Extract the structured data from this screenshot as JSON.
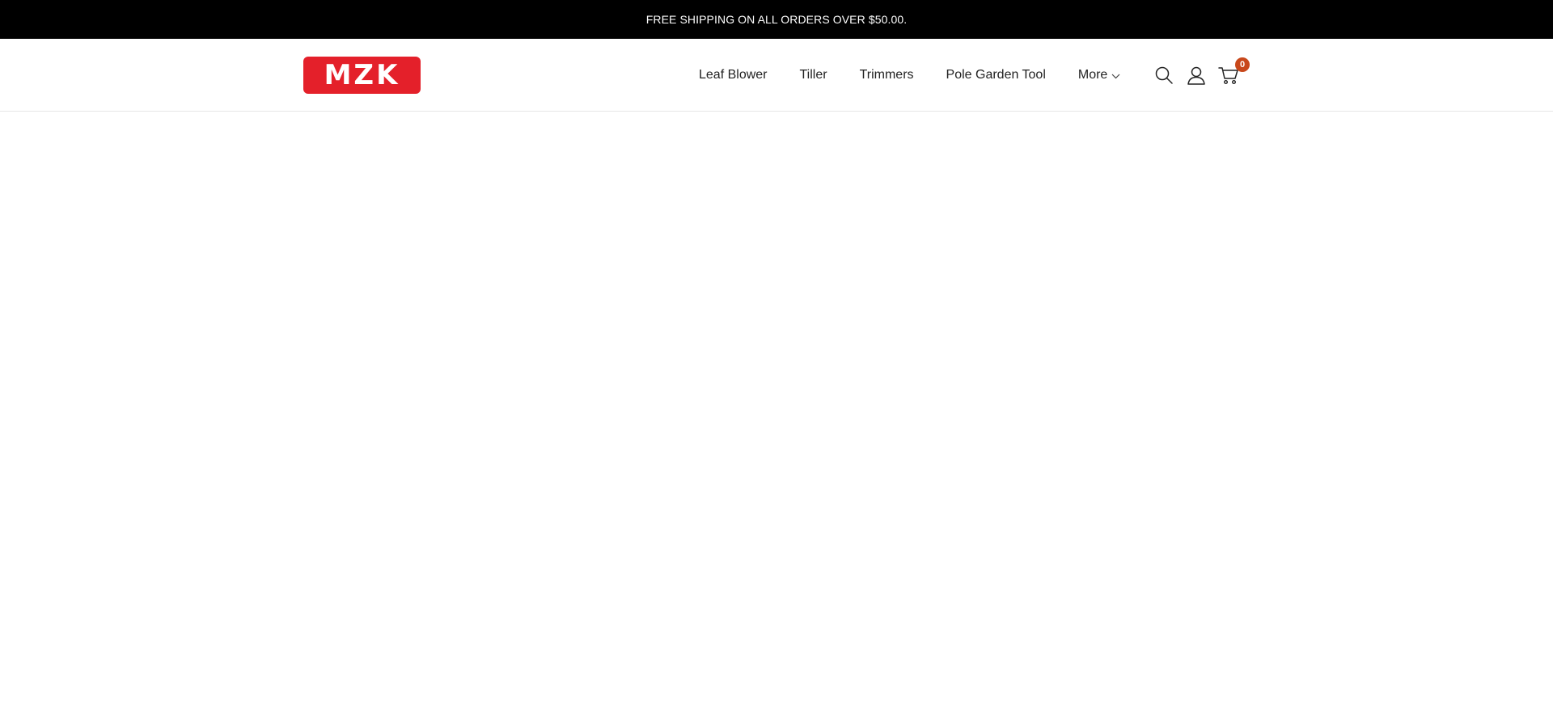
{
  "announcement": {
    "text": "FREE SHIPPING ON ALL ORDERS OVER $50.00."
  },
  "header": {
    "logo_text": "MZK",
    "nav": [
      {
        "label": "Leaf Blower"
      },
      {
        "label": "Tiller"
      },
      {
        "label": "Trimmers"
      },
      {
        "label": "Pole Garden Tool"
      },
      {
        "label": "More"
      }
    ],
    "cart_count": "0"
  },
  "icons": {
    "search": "search-icon",
    "account": "user-icon",
    "cart": "cart-icon",
    "more_dropdown": "chevron-down-icon"
  },
  "colors": {
    "announcement_bg": "#000000",
    "logo_bg": "#e4202a",
    "cart_badge": "#c8481b"
  }
}
